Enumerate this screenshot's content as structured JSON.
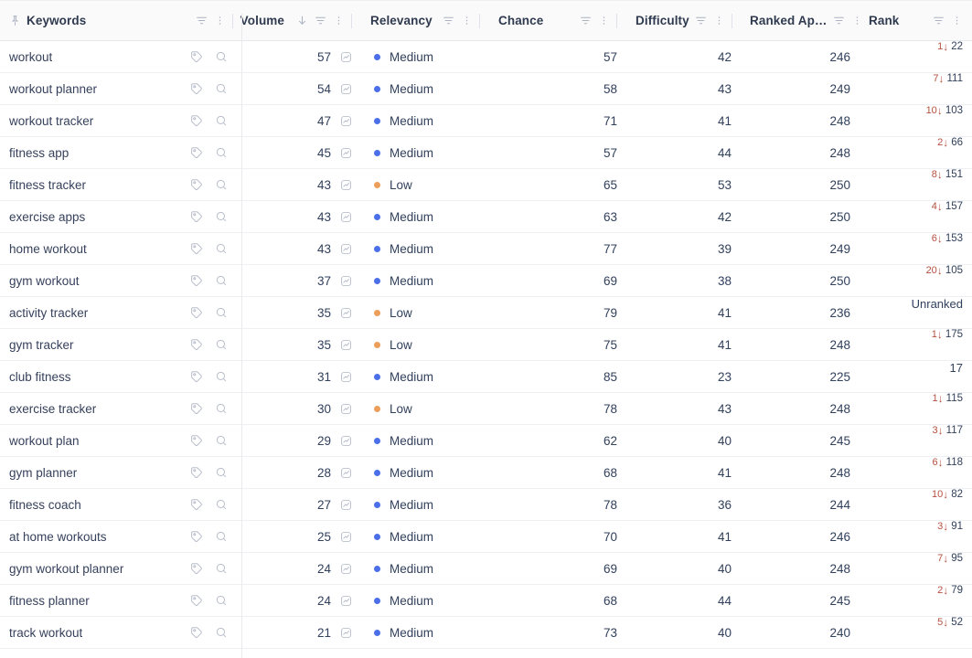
{
  "table": {
    "columns": [
      {
        "key": "keywords",
        "label": "Keywords",
        "align": "left",
        "pinned": true,
        "sorted": false,
        "has_filter": true,
        "has_menu": true
      },
      {
        "key": "volume",
        "label": "Volume",
        "align": "right",
        "pinned": false,
        "sorted": true,
        "sort_dir": "desc",
        "has_filter": true,
        "has_menu": true
      },
      {
        "key": "relevancy",
        "label": "Relevancy",
        "align": "left",
        "pinned": false,
        "sorted": false,
        "has_filter": true,
        "has_menu": true
      },
      {
        "key": "chance",
        "label": "Chance",
        "align": "left",
        "pinned": false,
        "sorted": false,
        "has_filter": true,
        "has_menu": true
      },
      {
        "key": "difficulty",
        "label": "Difficulty",
        "align": "left",
        "pinned": false,
        "sorted": false,
        "has_filter": true,
        "has_menu": true
      },
      {
        "key": "ranked_apps",
        "label": "Ranked Ap…",
        "align": "left",
        "pinned": false,
        "sorted": false,
        "has_filter": true,
        "has_menu": true
      },
      {
        "key": "rank",
        "label": "Rank",
        "align": "left",
        "pinned": false,
        "sorted": false,
        "has_filter": true,
        "has_menu": true
      }
    ],
    "rows": [
      {
        "keyword": "workout",
        "volume": 57,
        "relevancy": "Medium",
        "relevancy_level": "medium",
        "chance": 57,
        "difficulty": 42,
        "ranked_apps": 246,
        "rank": "22",
        "rank_delta": "1",
        "rank_dir": "down"
      },
      {
        "keyword": "workout planner",
        "volume": 54,
        "relevancy": "Medium",
        "relevancy_level": "medium",
        "chance": 58,
        "difficulty": 43,
        "ranked_apps": 249,
        "rank": "111",
        "rank_delta": "7",
        "rank_dir": "down"
      },
      {
        "keyword": "workout tracker",
        "volume": 47,
        "relevancy": "Medium",
        "relevancy_level": "medium",
        "chance": 71,
        "difficulty": 41,
        "ranked_apps": 248,
        "rank": "103",
        "rank_delta": "10",
        "rank_dir": "down"
      },
      {
        "keyword": "fitness app",
        "volume": 45,
        "relevancy": "Medium",
        "relevancy_level": "medium",
        "chance": 57,
        "difficulty": 44,
        "ranked_apps": 248,
        "rank": "66",
        "rank_delta": "2",
        "rank_dir": "down"
      },
      {
        "keyword": "fitness tracker",
        "volume": 43,
        "relevancy": "Low",
        "relevancy_level": "low",
        "chance": 65,
        "difficulty": 53,
        "ranked_apps": 250,
        "rank": "151",
        "rank_delta": "8",
        "rank_dir": "down"
      },
      {
        "keyword": "exercise apps",
        "volume": 43,
        "relevancy": "Medium",
        "relevancy_level": "medium",
        "chance": 63,
        "difficulty": 42,
        "ranked_apps": 250,
        "rank": "157",
        "rank_delta": "4",
        "rank_dir": "down"
      },
      {
        "keyword": "home workout",
        "volume": 43,
        "relevancy": "Medium",
        "relevancy_level": "medium",
        "chance": 77,
        "difficulty": 39,
        "ranked_apps": 249,
        "rank": "153",
        "rank_delta": "6",
        "rank_dir": "down"
      },
      {
        "keyword": "gym workout",
        "volume": 37,
        "relevancy": "Medium",
        "relevancy_level": "medium",
        "chance": 69,
        "difficulty": 38,
        "ranked_apps": 250,
        "rank": "105",
        "rank_delta": "20",
        "rank_dir": "down"
      },
      {
        "keyword": "activity tracker",
        "volume": 35,
        "relevancy": "Low",
        "relevancy_level": "low",
        "chance": 79,
        "difficulty": 41,
        "ranked_apps": 236,
        "rank": "Unranked",
        "rank_delta": "",
        "rank_dir": "none"
      },
      {
        "keyword": "gym tracker",
        "volume": 35,
        "relevancy": "Low",
        "relevancy_level": "low",
        "chance": 75,
        "difficulty": 41,
        "ranked_apps": 248,
        "rank": "175",
        "rank_delta": "1",
        "rank_dir": "down"
      },
      {
        "keyword": "club fitness",
        "volume": 31,
        "relevancy": "Medium",
        "relevancy_level": "medium",
        "chance": 85,
        "difficulty": 23,
        "ranked_apps": 225,
        "rank": "17",
        "rank_delta": "",
        "rank_dir": "none"
      },
      {
        "keyword": "exercise tracker",
        "volume": 30,
        "relevancy": "Low",
        "relevancy_level": "low",
        "chance": 78,
        "difficulty": 43,
        "ranked_apps": 248,
        "rank": "115",
        "rank_delta": "1",
        "rank_dir": "down"
      },
      {
        "keyword": "workout plan",
        "volume": 29,
        "relevancy": "Medium",
        "relevancy_level": "medium",
        "chance": 62,
        "difficulty": 40,
        "ranked_apps": 245,
        "rank": "117",
        "rank_delta": "3",
        "rank_dir": "down"
      },
      {
        "keyword": "gym planner",
        "volume": 28,
        "relevancy": "Medium",
        "relevancy_level": "medium",
        "chance": 68,
        "difficulty": 41,
        "ranked_apps": 248,
        "rank": "118",
        "rank_delta": "6",
        "rank_dir": "down"
      },
      {
        "keyword": "fitness coach",
        "volume": 27,
        "relevancy": "Medium",
        "relevancy_level": "medium",
        "chance": 78,
        "difficulty": 36,
        "ranked_apps": 244,
        "rank": "82",
        "rank_delta": "10",
        "rank_dir": "down"
      },
      {
        "keyword": "at home workouts",
        "volume": 25,
        "relevancy": "Medium",
        "relevancy_level": "medium",
        "chance": 70,
        "difficulty": 41,
        "ranked_apps": 246,
        "rank": "91",
        "rank_delta": "3",
        "rank_dir": "down"
      },
      {
        "keyword": "gym workout planner",
        "volume": 24,
        "relevancy": "Medium",
        "relevancy_level": "medium",
        "chance": 69,
        "difficulty": 40,
        "ranked_apps": 248,
        "rank": "95",
        "rank_delta": "7",
        "rank_dir": "down"
      },
      {
        "keyword": "fitness planner",
        "volume": 24,
        "relevancy": "Medium",
        "relevancy_level": "medium",
        "chance": 68,
        "difficulty": 44,
        "ranked_apps": 245,
        "rank": "79",
        "rank_delta": "2",
        "rank_dir": "down"
      },
      {
        "keyword": "track workout",
        "volume": 21,
        "relevancy": "Medium",
        "relevancy_level": "medium",
        "chance": 73,
        "difficulty": 40,
        "ranked_apps": 240,
        "rank": "52",
        "rank_delta": "5",
        "rank_dir": "down"
      }
    ]
  },
  "icons": {
    "pin": "pin-icon",
    "filter": "filter-icon",
    "menu": "more-options-icon",
    "sort_desc": "sort-descending-arrow-icon",
    "tag": "tag-icon",
    "search": "search-icon",
    "trend": "trend-chart-icon",
    "rank_down_arrow": "↓"
  },
  "colors": {
    "relevancy_medium": "#4b6fe8",
    "relevancy_low": "#eb9f5b",
    "rank_delta": "#b4503f",
    "text": "#31405c",
    "header_bg": "#fafafb",
    "row_border": "#eef0f3"
  }
}
